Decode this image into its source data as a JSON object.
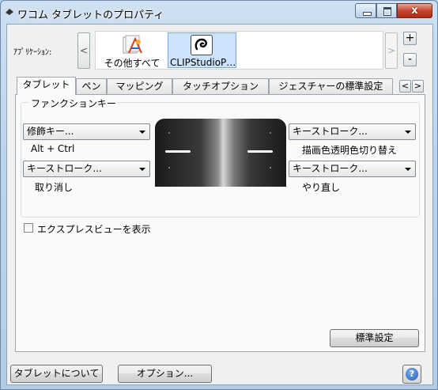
{
  "window": {
    "title": "ワコム タブレットのプロパティ",
    "close_glyph": "x"
  },
  "applications": {
    "label": "ｱﾌﾟﾘｹｰｼｮﾝ:",
    "left_arrow": "<",
    "right_arrow": ">",
    "add": "+",
    "remove": "-",
    "items": [
      {
        "name": "その他すべて",
        "icon": "all-apps-icon"
      },
      {
        "name": "CLIPStudioP…",
        "icon": "clip-studio-icon",
        "selected": true
      }
    ]
  },
  "tabs": [
    {
      "label": "タブレット",
      "active": true
    },
    {
      "label": "ペン"
    },
    {
      "label": "マッピング"
    },
    {
      "label": "タッチオプション"
    },
    {
      "label": "ジェスチャーの標準設定"
    }
  ],
  "tab_scroll": {
    "left": "<",
    "right": ">"
  },
  "function_keys": {
    "group_title": "ファンクションキー",
    "top_left": {
      "selected": "修飾キー...",
      "description": "Alt + Ctrl"
    },
    "bottom_left": {
      "selected": "キーストローク...",
      "description": "取り消し"
    },
    "top_right": {
      "selected": "キーストローク...",
      "description": "描画色透明色切り替え"
    },
    "bottom_right": {
      "selected": "キーストローク...",
      "description": "やり直し"
    }
  },
  "express_view": {
    "label": "エクスプレスビューを表示",
    "checked": false
  },
  "buttons": {
    "default": "標準設定",
    "about": "タブレットについて",
    "options": "オプション...",
    "help": "?"
  }
}
